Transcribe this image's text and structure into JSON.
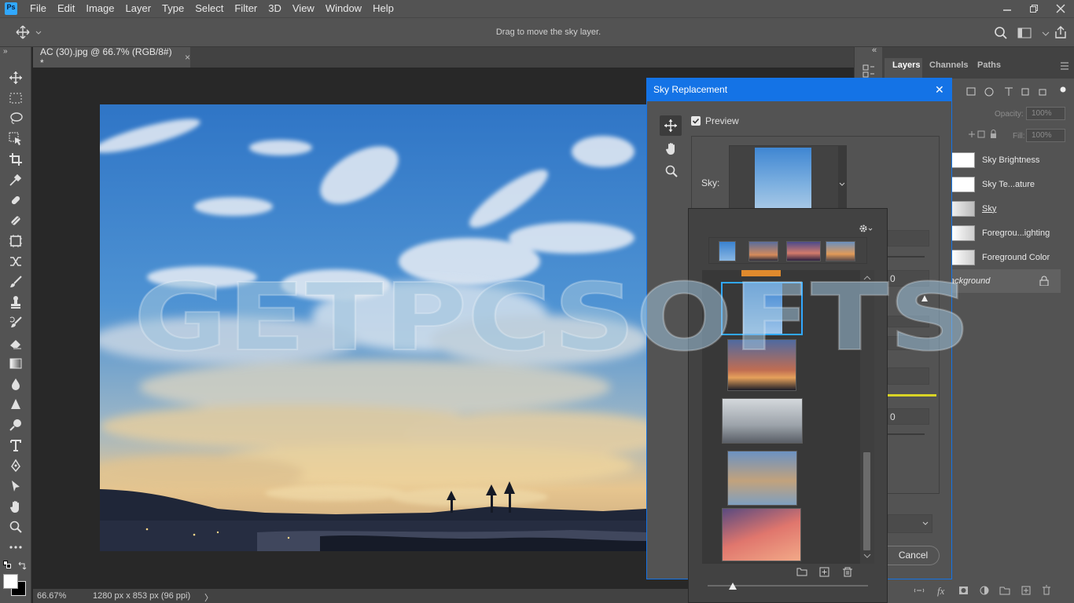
{
  "app": {
    "logo_text": "Ps"
  },
  "menu": [
    "File",
    "Edit",
    "Image",
    "Layer",
    "Type",
    "Select",
    "Filter",
    "3D",
    "View",
    "Window",
    "Help"
  ],
  "options_bar": {
    "hint": "Drag to move the sky layer."
  },
  "document": {
    "tab_title": "AC (30).jpg @ 66.7% (RGB/8#) *",
    "close_glyph": "×"
  },
  "status": {
    "zoom": "66.67%",
    "doc_info": "1280 px x 853 px (96 ppi)",
    "arrow": "〉"
  },
  "tools": [
    "move-icon",
    "marquee-icon",
    "lasso-icon",
    "object-select-icon",
    "crop-icon",
    "eyedropper-icon",
    "healing-icon",
    "brush-alt-icon",
    "frame-icon",
    "clone-stamp-icon",
    "brush-icon",
    "stamp-icon",
    "history-brush-icon",
    "eraser-icon",
    "gradient-icon",
    "blur-icon",
    "sharpen-icon",
    "dodge-icon",
    "type-icon",
    "pen-icon",
    "path-select-icon",
    "hand-icon",
    "zoom-icon",
    "more-icon"
  ],
  "layers_panel": {
    "tabs": [
      "Layers",
      "Channels",
      "Paths"
    ],
    "opacity_label": "Opacity:",
    "opacity_value": "100%",
    "fill_label": "Fill:",
    "fill_value": "100%",
    "layers": [
      "Sky Brightness",
      "Sky Te...ature",
      "Sky",
      "Foregrou...ighting",
      "Foreground Color",
      "ackground"
    ]
  },
  "dialog": {
    "title": "Sky Replacement",
    "close_glyph": "✕",
    "preview_label": "Preview",
    "sky_label": "Sky:",
    "cancel_label": "Cancel",
    "partial_values": [
      "0",
      "0"
    ]
  },
  "watermark": {
    "text": "GETPCSOFTS"
  },
  "colors": {
    "accent": "#1473e6",
    "panel": "#535353",
    "dark": "#424242",
    "canvas": "#282828"
  }
}
